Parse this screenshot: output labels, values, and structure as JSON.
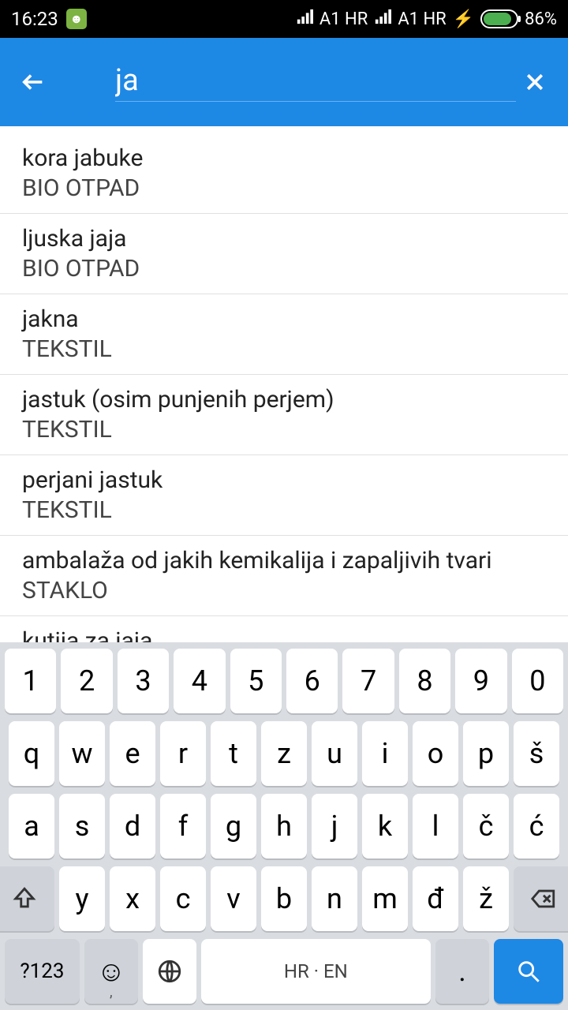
{
  "status": {
    "time": "16:23",
    "carrier1": "A1 HR",
    "carrier2": "A1 HR",
    "battery": "86%"
  },
  "search": {
    "value": "ja"
  },
  "results": [
    {
      "title": "kora jabuke",
      "category": "BIO OTPAD"
    },
    {
      "title": "ljuska jaja",
      "category": "BIO OTPAD"
    },
    {
      "title": "jakna",
      "category": "TEKSTIL"
    },
    {
      "title": "jastuk (osim punjenih perjem)",
      "category": "TEKSTIL"
    },
    {
      "title": "perjani jastuk",
      "category": "TEKSTIL"
    },
    {
      "title": "ambalaža od jakih kemikalija i zapaljivih tvari",
      "category": "STAKLO"
    },
    {
      "title": "kutija za jaja",
      "category": ""
    }
  ],
  "keyboard": {
    "row1": [
      "1",
      "2",
      "3",
      "4",
      "5",
      "6",
      "7",
      "8",
      "9",
      "0"
    ],
    "row2": [
      "q",
      "w",
      "e",
      "r",
      "t",
      "z",
      "u",
      "i",
      "o",
      "p",
      "š"
    ],
    "row3": [
      "a",
      "s",
      "d",
      "f",
      "g",
      "h",
      "j",
      "k",
      "l",
      "č",
      "ć"
    ],
    "row4": [
      "y",
      "x",
      "c",
      "v",
      "b",
      "n",
      "m",
      "đ",
      "ž"
    ],
    "sym": "?123",
    "comma_sub": ",",
    "space": "HR · EN",
    "period": "."
  }
}
